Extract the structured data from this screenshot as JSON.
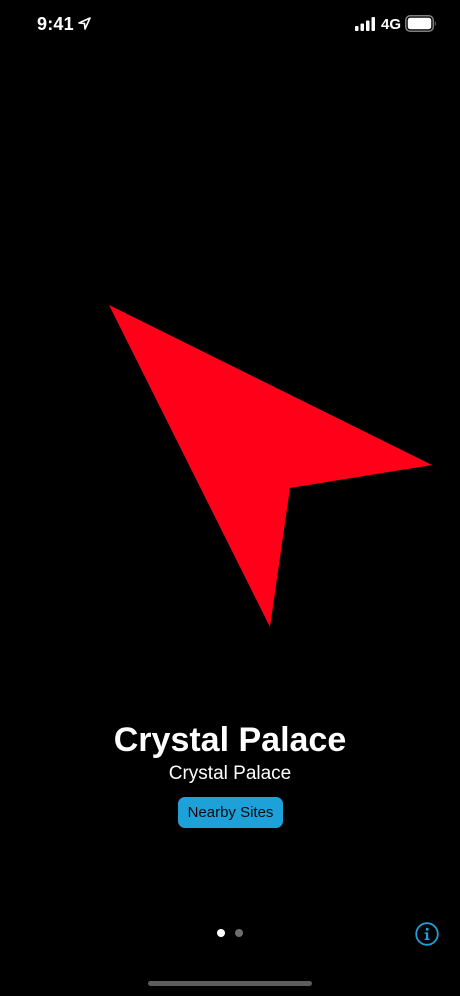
{
  "status_bar": {
    "time": "9:41",
    "network": "4G",
    "icons": [
      "location-arrow-icon",
      "signal-bars-icon",
      "battery-icon"
    ]
  },
  "pointer": {
    "icon": "direction-arrow-icon",
    "color": "#ff0018"
  },
  "place": {
    "title": "Crystal Palace",
    "subtitle": "Crystal Palace"
  },
  "nearby_button": {
    "label": "Nearby Sites",
    "color": "#1da1d8"
  },
  "pager": {
    "page_count": 2,
    "current_page": 1
  },
  "info_button": {
    "icon": "info-icon",
    "color": "#1da1d8"
  }
}
